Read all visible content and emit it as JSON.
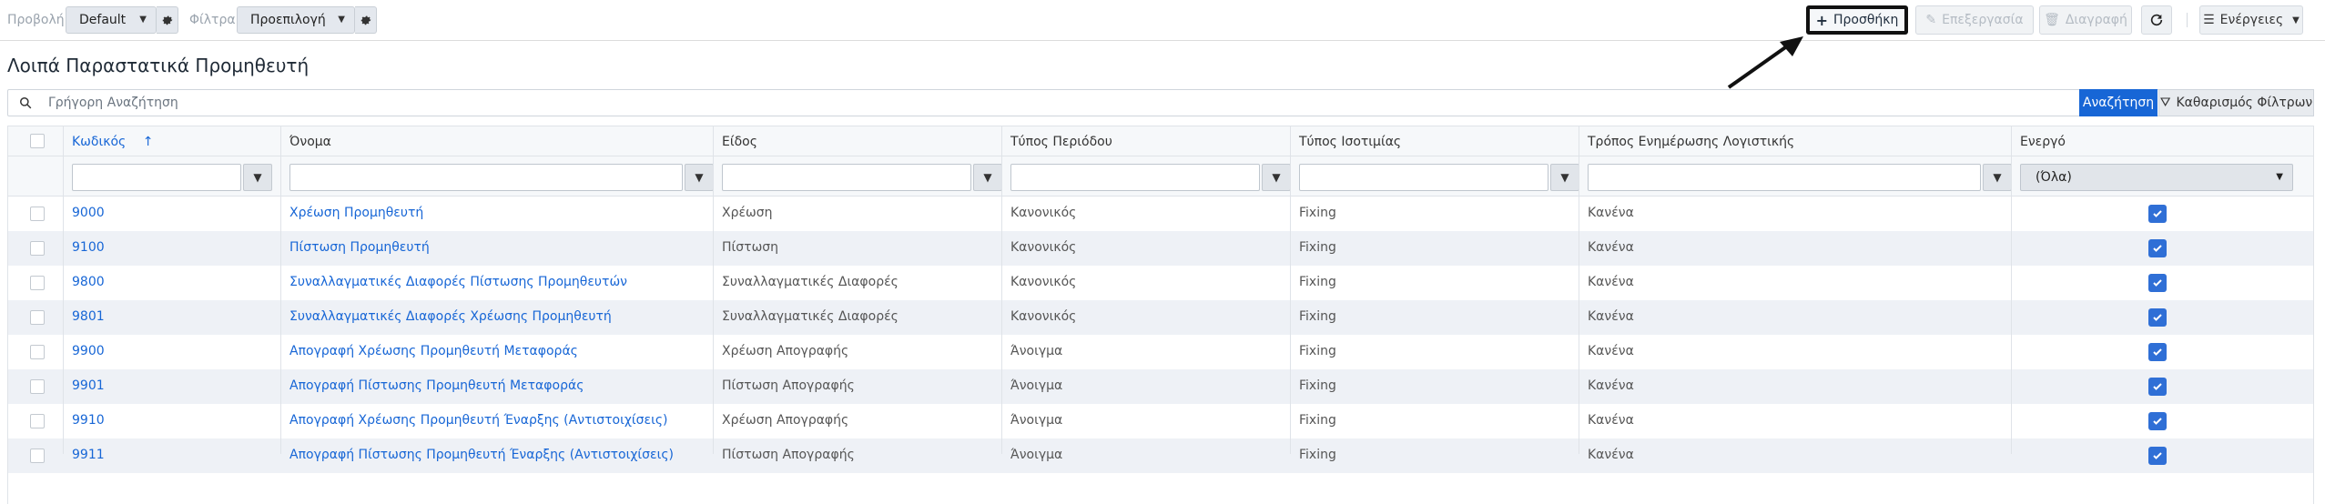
{
  "toolbar": {
    "view_label": "Προβολή",
    "view_value": "Default",
    "filter_label": "Φίλτρα",
    "filter_value": "Προεπιλογή",
    "add_label": "Προσθήκη",
    "edit_label": "Επεξεργασία",
    "delete_label": "Διαγραφή",
    "actions_label": "Ενέργειες"
  },
  "page": {
    "title": "Λοιπά Παραστατικά Προμηθευτή"
  },
  "search": {
    "placeholder": "Γρήγορη Αναζήτηση",
    "search_button": "Αναζήτηση",
    "clear_button": "Καθαρισμός Φίλτρων"
  },
  "grid": {
    "columns": [
      "Κωδικός",
      "Όνομα",
      "Είδος",
      "Τύπος Περιόδου",
      "Τύπος Ισοτιμίας",
      "Τρόπος Ενημέρωσης Λογιστικής",
      "Ενεργό"
    ],
    "sort_indicator": "↑",
    "active_filter_value": "(Όλα)",
    "rows": [
      {
        "code": "9000",
        "name": "Χρέωση Προμηθευτή",
        "kind": "Χρέωση",
        "period": "Κανονικός",
        "rate": "Fixing",
        "accounting": "Κανένα",
        "active": true
      },
      {
        "code": "9100",
        "name": "Πίστωση Προμηθευτή",
        "kind": "Πίστωση",
        "period": "Κανονικός",
        "rate": "Fixing",
        "accounting": "Κανένα",
        "active": true
      },
      {
        "code": "9800",
        "name": "Συναλλαγματικές Διαφορές Πίστωσης Προμηθευτών",
        "kind": "Συναλλαγματικές Διαφορές",
        "period": "Κανονικός",
        "rate": "Fixing",
        "accounting": "Κανένα",
        "active": true
      },
      {
        "code": "9801",
        "name": "Συναλλαγματικές Διαφορές Χρέωσης Προμηθευτή",
        "kind": "Συναλλαγματικές Διαφορές",
        "period": "Κανονικός",
        "rate": "Fixing",
        "accounting": "Κανένα",
        "active": true
      },
      {
        "code": "9900",
        "name": "Απογραφή Χρέωσης Προμηθευτή Μεταφοράς",
        "kind": "Χρέωση Απογραφής",
        "period": "Άνοιγμα",
        "rate": "Fixing",
        "accounting": "Κανένα",
        "active": true
      },
      {
        "code": "9901",
        "name": "Απογραφή Πίστωσης Προμηθευτή Μεταφοράς",
        "kind": "Πίστωση Απογραφής",
        "period": "Άνοιγμα",
        "rate": "Fixing",
        "accounting": "Κανένα",
        "active": true
      },
      {
        "code": "9910",
        "name": "Απογραφή Χρέωσης Προμηθευτή Έναρξης (Αντιστοιχίσεις)",
        "kind": "Χρέωση Απογραφής",
        "period": "Άνοιγμα",
        "rate": "Fixing",
        "accounting": "Κανένα",
        "active": true
      },
      {
        "code": "9911",
        "name": "Απογραφή Πίστωσης Προμηθευτή Έναρξης (Αντιστοιχίσεις)",
        "kind": "Πίστωση Απογραφής",
        "period": "Άνοιγμα",
        "rate": "Fixing",
        "accounting": "Κανένα",
        "active": true
      }
    ]
  },
  "colors": {
    "accent": "#1766d6",
    "checkbox": "#2f6fd6",
    "row_alt": "#eef1f6"
  }
}
